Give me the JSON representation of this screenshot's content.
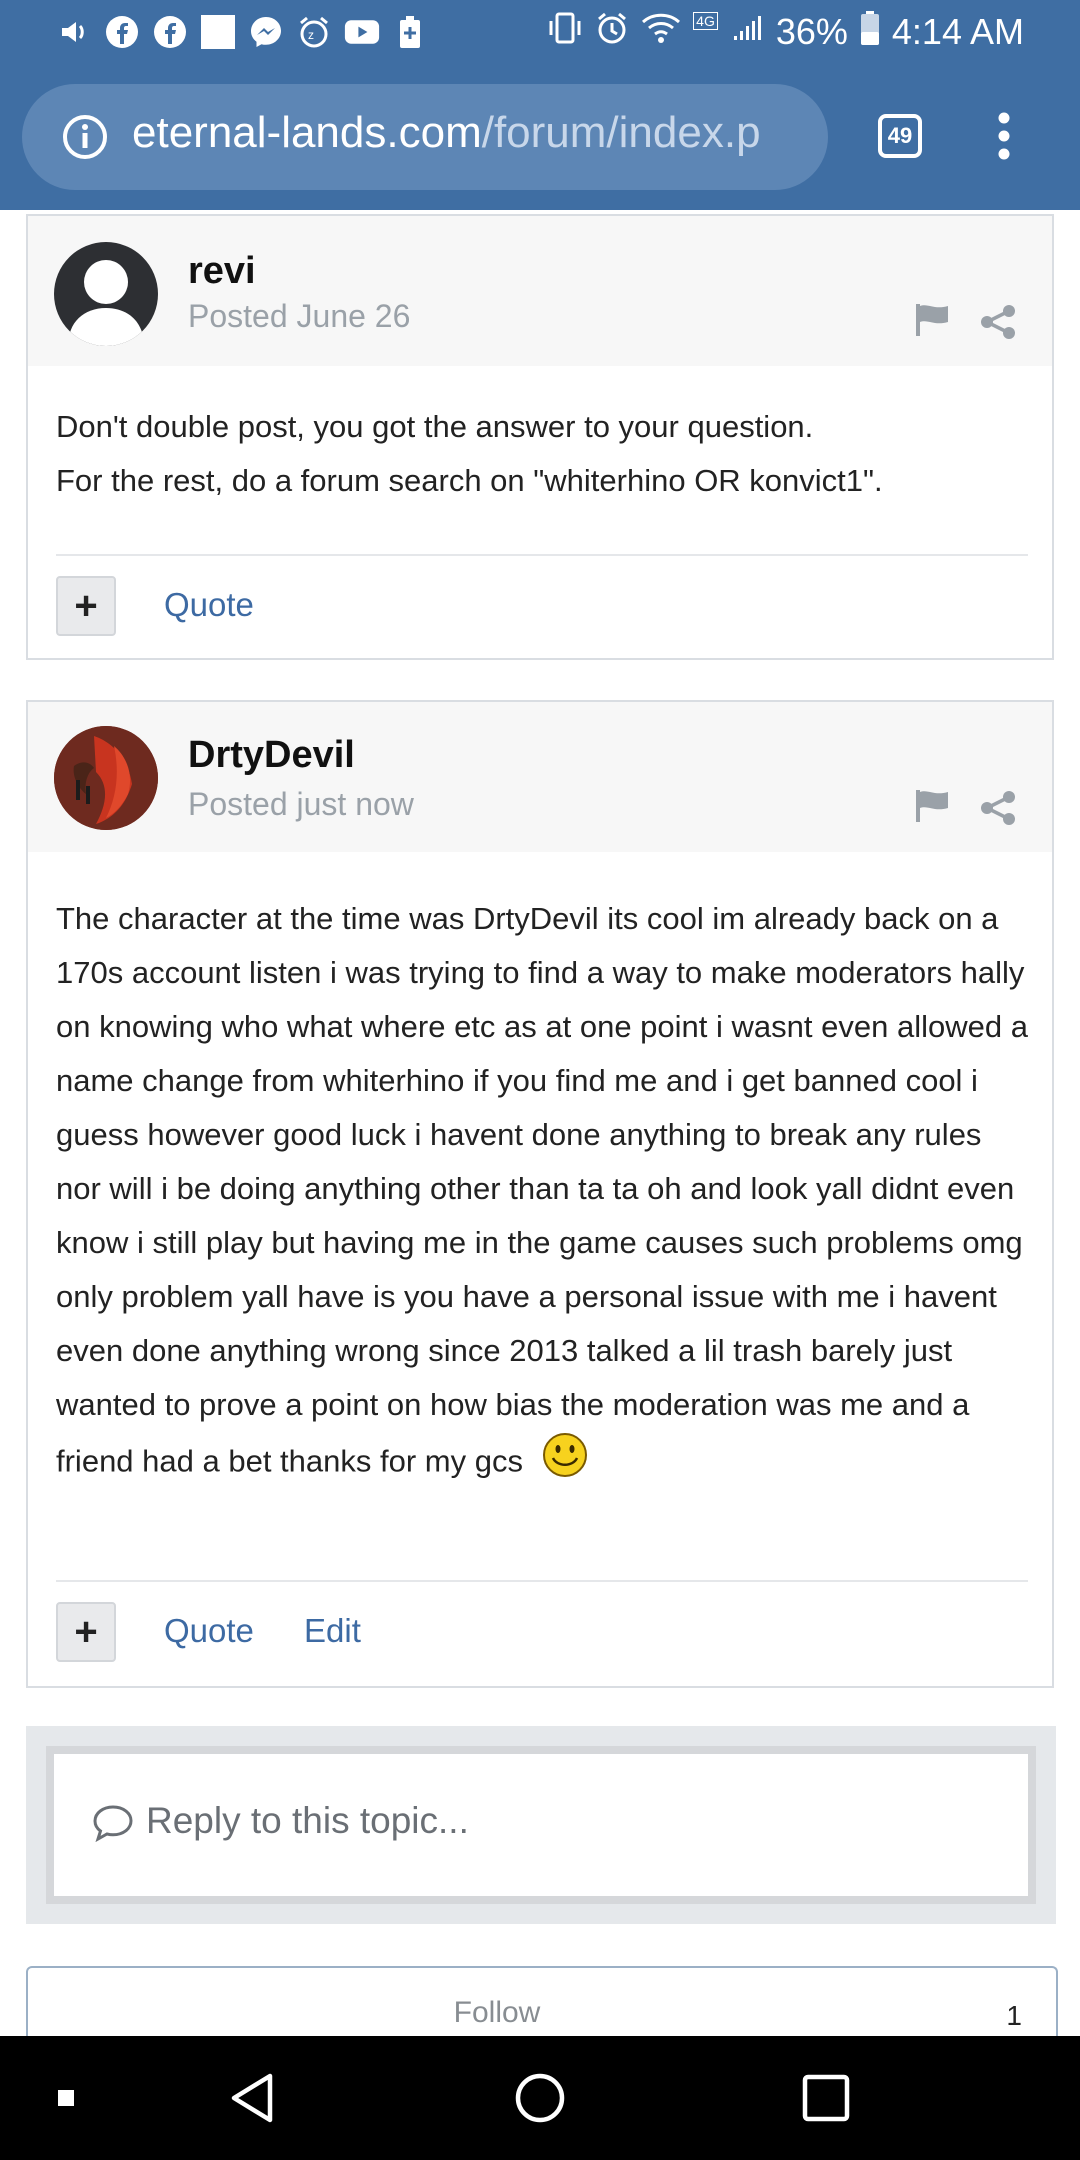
{
  "status_bar": {
    "battery": "36%",
    "time": "4:14 AM",
    "network_badge": "4G",
    "icons_left": [
      "volume-icon",
      "facebook-icon",
      "facebook-icon",
      "photo-icon",
      "messenger-icon",
      "alarm-snooze-icon",
      "youtube-icon",
      "battery-saver-icon"
    ],
    "icons_right": [
      "vibrate-icon",
      "alarm-icon",
      "wifi-icon",
      "signal-icon"
    ]
  },
  "browser": {
    "url_host": "eternal-lands.com",
    "url_path": "/forum/index.p",
    "tab_count": "49"
  },
  "posts": [
    {
      "author": "revi",
      "posted": "Posted June 26",
      "body": [
        "Don't double post, you got the answer to your question.",
        "For the rest, do a forum search on \"whiterhino OR konvict1\"."
      ],
      "actions": {
        "plus": "+",
        "quote": "Quote"
      }
    },
    {
      "author": "DrtyDevil",
      "posted": "Posted just now",
      "body": "The character at the time was DrtyDevil its cool im already back on a 170s account listen i was trying to find a way to make moderators hally on knowing who what where etc as at one point i wasnt even allowed a name change from whiterhino if you find me and i get banned cool i guess however good luck i havent done anything to break any rules nor will i be doing anything other than ta ta oh and look yall didnt even know i still play but having me in the game causes such problems omg only problem yall have is you have a personal issue with me i havent even done anything wrong since 2013 talked a lil trash barely just wanted to prove a point on how bias the moderation was me and a friend had a bet thanks for my gcs",
      "actions": {
        "plus": "+",
        "quote": "Quote",
        "edit": "Edit"
      }
    }
  ],
  "reply": {
    "placeholder": "Reply to this topic..."
  },
  "follow": {
    "label": "Follow",
    "count": "1"
  },
  "colors": {
    "header": "#3f6ea3",
    "link": "#3d6aa3",
    "muted": "#9aa1a8"
  }
}
